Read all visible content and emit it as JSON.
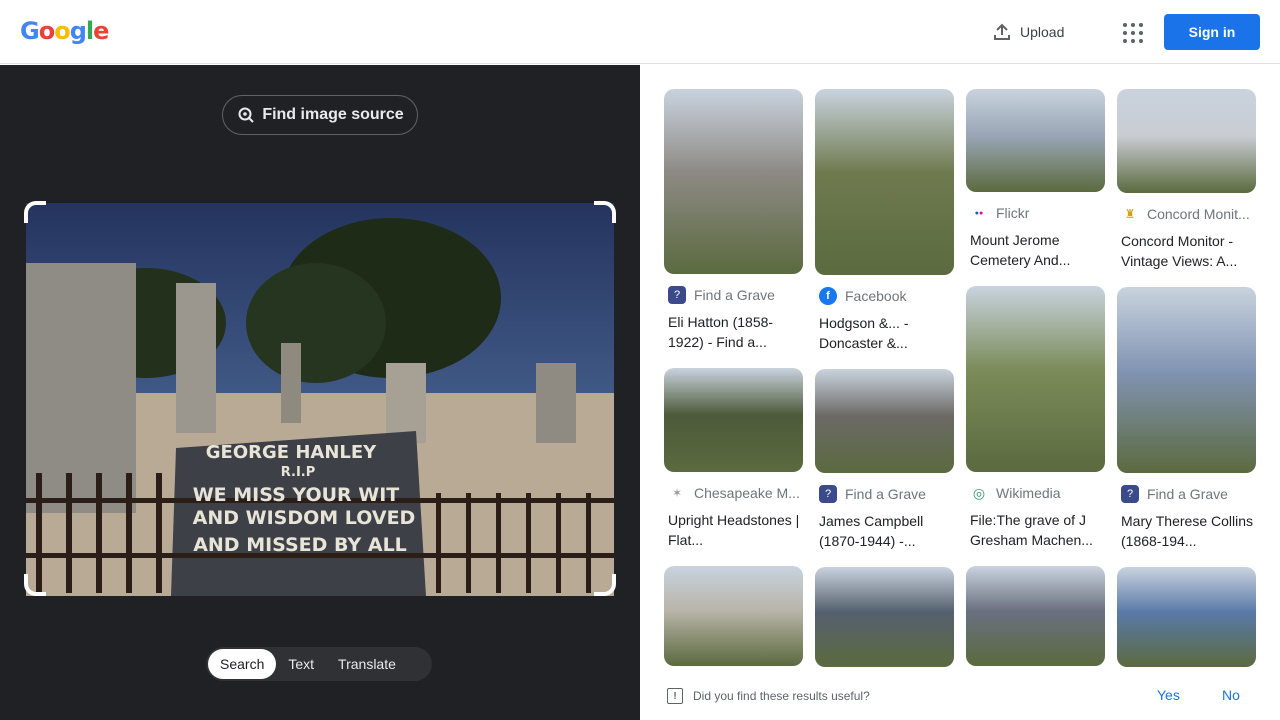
{
  "header": {
    "logo": [
      "G",
      "o",
      "o",
      "g",
      "l",
      "e"
    ],
    "logo_colors": [
      "#4285f4",
      "#ea4335",
      "#fbbc05",
      "#4285f4",
      "#34a853",
      "#ea4335"
    ],
    "upload_label": "Upload",
    "signin_label": "Sign in"
  },
  "lens": {
    "find_source_label": "Find image source",
    "modes": [
      "Search",
      "Text",
      "Translate"
    ],
    "active_mode": "Search",
    "photo_sign_lines": [
      "GEORGE HANLEY",
      "R.I.P",
      "WE MISS YOUR WIT",
      "AND WISDOM LOVED",
      "AND MISSED BY ALL"
    ]
  },
  "results": {
    "columns": [
      [
        {
          "source": "Find a Grave",
          "icon": "find-a-grave-icon",
          "title": "Eli Hatton (1858-1922) - Find a...",
          "color": "#8d8a85",
          "thumb_h": 185
        },
        {
          "source": "Chesapeake M...",
          "icon": "chesapeake-icon",
          "title": "Upright Headstones | Flat...",
          "color": "#4d5a3a",
          "thumb_h": 104
        },
        {
          "source": "",
          "icon": "",
          "title": "",
          "color": "#b8b4a8",
          "thumb_h": 100
        }
      ],
      [
        {
          "source": "Facebook",
          "icon": "facebook-icon",
          "title": "Hodgson &... - Doncaster &...",
          "color": "#6f7a4f",
          "thumb_h": 186
        },
        {
          "source": "Find a Grave",
          "icon": "find-a-grave-icon",
          "title": "James Campbell (1870-1944) -...",
          "color": "#6b6a66",
          "thumb_h": 104
        },
        {
          "source": "",
          "icon": "",
          "title": "",
          "color": "#55606e",
          "thumb_h": 100
        }
      ],
      [
        {
          "source": "Flickr",
          "icon": "flickr-icon",
          "title": "Mount Jerome Cemetery And...",
          "color": "#9aa6b6",
          "thumb_h": 103
        },
        {
          "source": "Wikimedia",
          "icon": "wikimedia-icon",
          "title": "File:The grave of J Gresham Machen...",
          "color": "#7b8c5a",
          "thumb_h": 186
        },
        {
          "source": "",
          "icon": "",
          "title": "",
          "color": "#6a7080",
          "thumb_h": 100
        }
      ],
      [
        {
          "source": "Concord Monit...",
          "icon": "concord-monitor-icon",
          "title": "Concord Monitor - Vintage Views: A...",
          "color": "#c9ccd3",
          "thumb_h": 104
        },
        {
          "source": "Find a Grave",
          "icon": "find-a-grave-icon",
          "title": "Mary Therese Collins (1868-194...",
          "color": "#8294b4",
          "thumb_h": 186
        },
        {
          "source": "",
          "icon": "",
          "title": "",
          "color": "#5a7aa8",
          "thumb_h": 100
        }
      ]
    ]
  },
  "feedback": {
    "question": "Did you find these results useful?",
    "yes": "Yes",
    "no": "No"
  }
}
